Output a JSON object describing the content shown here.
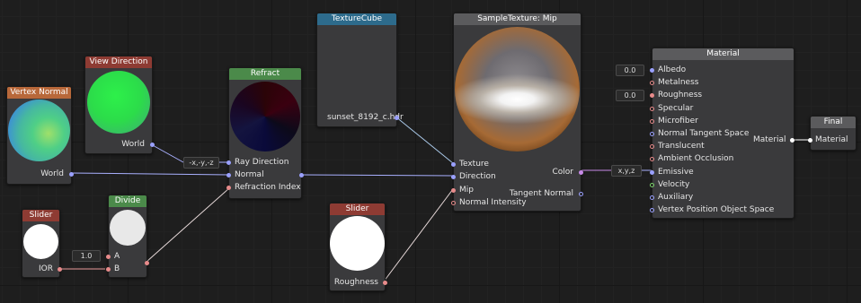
{
  "nodes": {
    "vertex_normal": {
      "title": "Vertex Normal",
      "out": "World"
    },
    "view_direction": {
      "title": "View Direction",
      "out": "World"
    },
    "refract": {
      "title": "Refract",
      "inputs": [
        "Ray Direction",
        "Normal",
        "Refraction Index"
      ],
      "swizzle": "-x,-y,-z"
    },
    "texture_cube": {
      "title": "TextureCube",
      "asset": "sunset_8192_c.hdr"
    },
    "sample_texture": {
      "title": "SampleTexture: Mip",
      "inputs": [
        "Texture",
        "Direction",
        "Mip",
        "Normal Intensity"
      ],
      "outputs": [
        "Color",
        "Tangent Normal"
      ]
    },
    "slider_ior": {
      "title": "Slider",
      "out": "IOR"
    },
    "divide": {
      "title": "Divide",
      "a_label": "A",
      "b_label": "B",
      "a_value": "1.0"
    },
    "slider_rough": {
      "title": "Slider",
      "out": "Roughness"
    },
    "material": {
      "title": "Material",
      "inputs": [
        "Albedo",
        "Metalness",
        "Roughness",
        "Specular",
        "Microfiber",
        "Normal Tangent Space",
        "Translucent",
        "Ambient Occlusion",
        "Emissive",
        "Velocity",
        "Auxiliary",
        "Vertex Position Object Space"
      ],
      "albedo_value": "0.0",
      "roughness_value": "0.0",
      "out": "Material",
      "emissive_swizzle": "x,y,z"
    },
    "final": {
      "title": "Final",
      "input": "Material"
    }
  },
  "colors": {
    "canvas": "#1e1e1e",
    "node_body": "#3a3a3c",
    "header_red": "#8e3b33",
    "header_orange": "#b8683a",
    "header_green": "#4b8a4a",
    "header_blue": "#2d6b8c",
    "header_gray": "#5b5b5d",
    "port_blue": "#9aa0ff",
    "port_pink": "#e88b8b",
    "port_purple": "#c88be8",
    "port_green": "#7bd36b"
  }
}
